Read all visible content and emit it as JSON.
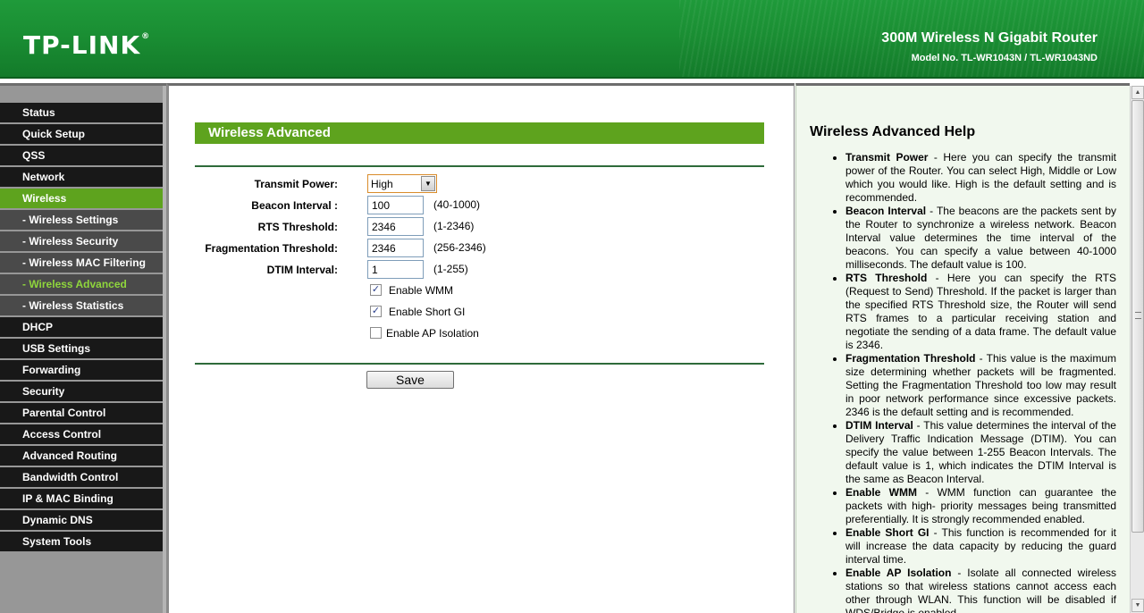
{
  "header": {
    "logo": "TP-LINK",
    "logo_mark": "®",
    "product": "300M Wireless N Gigabit Router",
    "model": "Model No. TL-WR1043N / TL-WR1043ND"
  },
  "colors": {
    "header_green": "#1a8e33",
    "accent_green": "#5ea31e",
    "menu_dark": "#181818",
    "help_bg": "#f1f8ee"
  },
  "menu": {
    "items": [
      {
        "label": "Status"
      },
      {
        "label": "Quick Setup"
      },
      {
        "label": "QSS"
      },
      {
        "label": "Network"
      },
      {
        "label": "Wireless",
        "active": true
      },
      {
        "label": "- Wireless Settings",
        "sub": true
      },
      {
        "label": "- Wireless Security",
        "sub": true
      },
      {
        "label": "- Wireless MAC Filtering",
        "sub": true
      },
      {
        "label": "- Wireless Advanced",
        "sub": true,
        "active": true
      },
      {
        "label": "- Wireless Statistics",
        "sub": true
      },
      {
        "label": "DHCP"
      },
      {
        "label": "USB Settings"
      },
      {
        "label": "Forwarding"
      },
      {
        "label": "Security"
      },
      {
        "label": "Parental Control"
      },
      {
        "label": "Access Control"
      },
      {
        "label": "Advanced Routing"
      },
      {
        "label": "Bandwidth Control"
      },
      {
        "label": "IP & MAC Binding"
      },
      {
        "label": "Dynamic DNS"
      },
      {
        "label": "System Tools"
      }
    ]
  },
  "form": {
    "title": "Wireless Advanced",
    "transmit_power": {
      "label": "Transmit Power:",
      "value": "High",
      "arrow": "▼"
    },
    "beacon_interval": {
      "label": "Beacon Interval :",
      "value": "100",
      "range": "(40-1000)"
    },
    "rts_threshold": {
      "label": "RTS Threshold:",
      "value": "2346",
      "range": "(1-2346)"
    },
    "fragmentation_threshold": {
      "label": "Fragmentation Threshold:",
      "value": "2346",
      "range": "(256-2346)"
    },
    "dtim_interval": {
      "label": "DTIM Interval:",
      "value": "1",
      "range": "(1-255)"
    },
    "enable_wmm": {
      "label": "Enable WMM",
      "checked": true,
      "mark": "✓"
    },
    "enable_short_gi": {
      "label": "Enable Short GI",
      "checked": true,
      "mark": "✓"
    },
    "enable_ap_isolation": {
      "label": "Enable AP Isolation",
      "checked": false,
      "mark": ""
    },
    "save_label": "Save"
  },
  "help": {
    "title": "Wireless Advanced Help",
    "items": [
      {
        "term": "Transmit Power",
        "text": " - Here you can specify the transmit power of the Router. You can select High, Middle or Low which you would like. High is the default setting and is recommended."
      },
      {
        "term": "Beacon Interval",
        "text": " - The beacons are the packets sent by the Router to synchronize a wireless network. Beacon Interval value determines the time interval of the beacons. You can specify a value between 40-1000 milliseconds. The default value is 100."
      },
      {
        "term": "RTS Threshold",
        "text": " - Here you can specify the RTS (Request to Send) Threshold. If the packet is larger than the specified RTS Threshold size, the Router will send RTS frames to a particular receiving station and negotiate the sending of a data frame. The default value is 2346."
      },
      {
        "term": "Fragmentation Threshold",
        "text": " - This value is the maximum size determining whether packets will be fragmented. Setting the Fragmentation Threshold too low may result in poor network performance since excessive packets. 2346 is the default setting and is recommended."
      },
      {
        "term": "DTIM Interval",
        "text": " - This value determines the interval of the Delivery Traffic Indication Message (DTIM). You can specify the value between 1-255 Beacon Intervals. The default value is 1, which indicates the DTIM Interval is the same as Beacon Interval."
      },
      {
        "term": "Enable WMM",
        "text": " - WMM function can guarantee the packets with high- priority messages being transmitted preferentially. It is strongly recommended enabled."
      },
      {
        "term": "Enable Short GI",
        "text": " - This function is recommended for it will increase the data capacity by reducing the guard interval time."
      },
      {
        "term": "Enable AP Isolation",
        "text": " - Isolate all connected wireless stations so that wireless stations cannot access each other through WLAN. This function will be disabled if WDS/Bridge is enabled."
      }
    ]
  },
  "scrollbar": {
    "up_arrow": "▲",
    "down_arrow": "▼"
  }
}
